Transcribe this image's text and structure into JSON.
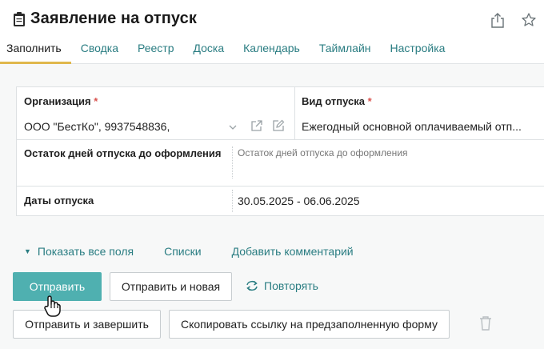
{
  "header": {
    "title": "Заявление на отпуск",
    "title_icon": "clipboard-icon",
    "actions": [
      "share-icon",
      "star-icon"
    ]
  },
  "tabs": [
    {
      "label": "Заполнить",
      "active": true
    },
    {
      "label": "Сводка",
      "active": false
    },
    {
      "label": "Реестр",
      "active": false
    },
    {
      "label": "Доска",
      "active": false
    },
    {
      "label": "Календарь",
      "active": false
    },
    {
      "label": "Таймлайн",
      "active": false
    },
    {
      "label": "Настройка",
      "active": false
    }
  ],
  "form": {
    "organization": {
      "label": "Организация",
      "required_mark": "*",
      "value": "ООО \"БестКо\", 9937548836,"
    },
    "vacation_type": {
      "label": "Вид отпуска",
      "required_mark": "*",
      "value": "Ежегодный основной оплачиваемый отп..."
    },
    "remaining_days": {
      "label": "Остаток дней отпуска до оформления",
      "placeholder": "Остаток дней отпуска до оформления"
    },
    "dates": {
      "label": "Даты отпуска",
      "value": "30.05.2025 - 06.06.2025"
    }
  },
  "links": {
    "show_all": "Показать все поля",
    "lists": "Списки",
    "add_comment": "Добавить комментарий"
  },
  "buttons": {
    "submit": "Отправить",
    "submit_new": "Отправить и новая",
    "repeat": "Повторять",
    "submit_finish": "Отправить и завершить",
    "copy_link": "Скопировать ссылку на предзаполненную форму"
  },
  "colors": {
    "accent": "#2a7d82",
    "primary_button": "#4fb0b0",
    "active_tab_underline": "#e0b84c",
    "required": "#d9534f"
  }
}
